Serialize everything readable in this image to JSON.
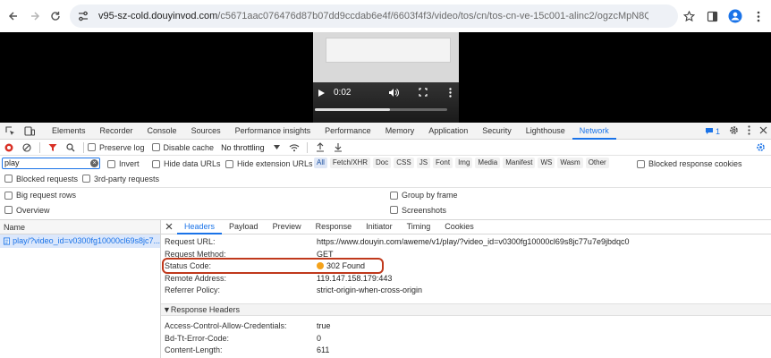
{
  "browser": {
    "url_host": "v95-sz-cold.douyinvod.com",
    "url_path": "/c5671aac076476d87b07dd9ccdab6e4f/6603f4f3/video/tos/cn/tos-cn-ve-15c001-alinc2/ogzcMpN8Qa6kyfH..."
  },
  "video": {
    "time": "0:02",
    "progress_fraction": 0.57
  },
  "devtools_tabs": [
    "Elements",
    "Recorder",
    "Console",
    "Sources",
    "Performance insights",
    "Performance",
    "Memory",
    "Application",
    "Security",
    "Lighthouse",
    "Network"
  ],
  "active_tab": "Network",
  "issues_count": "1",
  "toolbar": {
    "preserve_log": "Preserve log",
    "disable_cache": "Disable cache",
    "throttling": "No throttling"
  },
  "filter": {
    "value": "play",
    "invert": "Invert",
    "hide_data_urls": "Hide data URLs",
    "hide_extension_urls": "Hide extension URLs",
    "types": [
      "All",
      "Fetch/XHR",
      "Doc",
      "CSS",
      "JS",
      "Font",
      "Img",
      "Media",
      "Manifest",
      "WS",
      "Wasm",
      "Other"
    ],
    "blocked_response_cookies": "Blocked response cookies",
    "blocked_requests": "Blocked requests",
    "third_party": "3rd-party requests"
  },
  "options": {
    "big_request_rows": "Big request rows",
    "group_by_frame": "Group by frame",
    "overview": "Overview",
    "screenshots": "Screenshots"
  },
  "requests": {
    "header": "Name",
    "items": [
      "play/?video_id=v0300fg10000cl69s8jc7..."
    ]
  },
  "detail_tabs": [
    "Headers",
    "Payload",
    "Preview",
    "Response",
    "Initiator",
    "Timing",
    "Cookies"
  ],
  "general": [
    {
      "key": "Request URL:",
      "value": "https://www.douyin.com/aweme/v1/play/?video_id=v0300fg10000cl69s8jc77u7e9jbdqc0"
    },
    {
      "key": "Request Method:",
      "value": "GET"
    },
    {
      "key": "Status Code:",
      "value": "302 Found"
    },
    {
      "key": "Remote Address:",
      "value": "119.147.158.179:443"
    },
    {
      "key": "Referrer Policy:",
      "value": "strict-origin-when-cross-origin"
    }
  ],
  "response_headers_title": "▼Response Headers",
  "response_headers": [
    {
      "key": "Access-Control-Allow-Credentials:",
      "value": "true"
    },
    {
      "key": "Bd-Tt-Error-Code:",
      "value": "0"
    },
    {
      "key": "Content-Length:",
      "value": "611"
    }
  ],
  "colors": {
    "accent": "#1a73e8",
    "status_dot": "#f4a21b",
    "highlight_border": "#c0391c"
  }
}
